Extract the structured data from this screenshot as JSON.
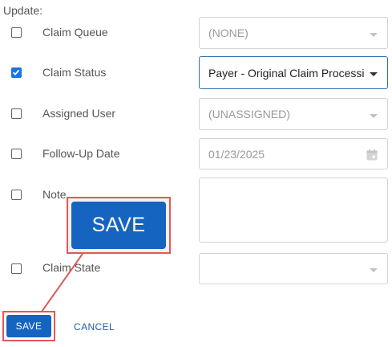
{
  "form": {
    "update_label": "Update:",
    "rows": [
      {
        "label": "Claim Queue",
        "checked": false,
        "value": "(NONE)",
        "control": "select"
      },
      {
        "label": "Claim Status",
        "checked": true,
        "value": "Payer - Original Claim Processing",
        "control": "select"
      },
      {
        "label": "Assigned User",
        "checked": false,
        "value": "(UNASSIGNED)",
        "control": "select"
      },
      {
        "label": "Follow-Up Date",
        "checked": false,
        "value": "01/23/2025",
        "control": "date"
      },
      {
        "label": "Note",
        "checked": false,
        "value": "",
        "control": "textarea"
      },
      {
        "label": "Claim State",
        "checked": false,
        "value": "",
        "control": "select"
      }
    ]
  },
  "actions": {
    "save_label": "SAVE",
    "cancel_label": "CANCEL"
  },
  "callout": {
    "save_zoom_label": "SAVE"
  },
  "colors": {
    "primary": "#1565c0",
    "highlight": "#e2575a",
    "checkbox": "#1a73e8"
  }
}
